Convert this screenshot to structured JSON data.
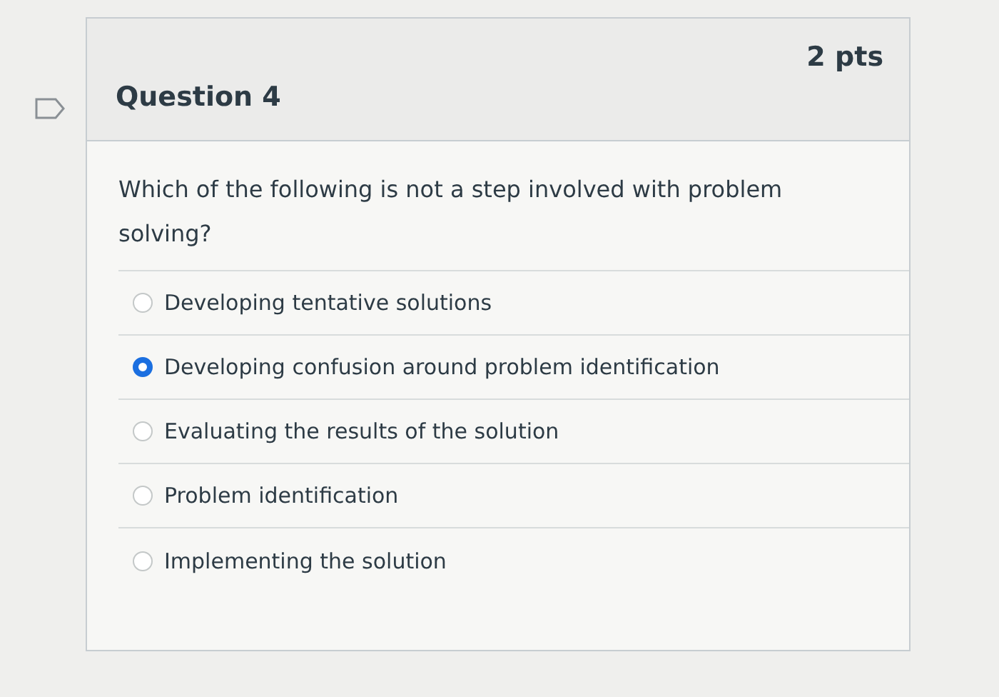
{
  "question": {
    "title": "Question 4",
    "points": "2 pts",
    "flagged": false,
    "text": "Which of the following is not a step involved with problem solving?",
    "answers": [
      {
        "label": "Developing tentative solutions",
        "selected": false
      },
      {
        "label": "Developing confusion around problem identification",
        "selected": true
      },
      {
        "label": "Evaluating the results of the solution",
        "selected": false
      },
      {
        "label": "Problem identification",
        "selected": false
      },
      {
        "label": "Implementing the solution",
        "selected": false
      }
    ]
  }
}
